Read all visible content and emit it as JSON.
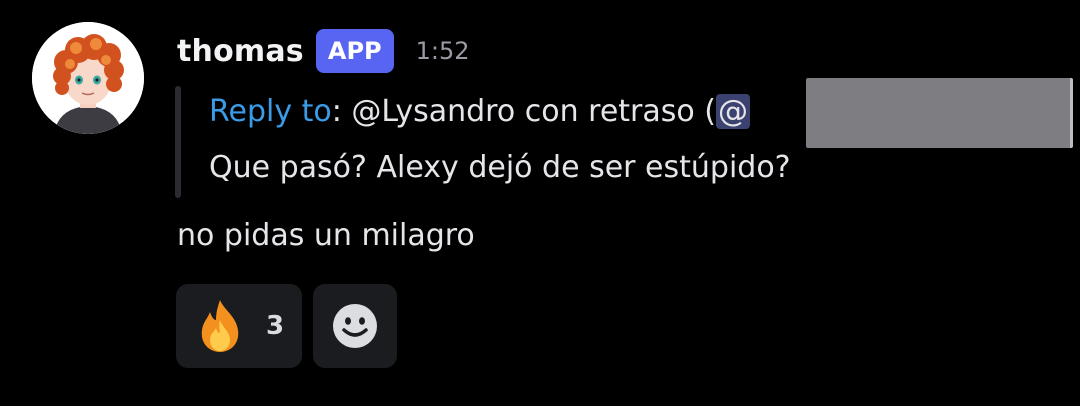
{
  "message": {
    "author": "thomas",
    "badge": "APP",
    "timestamp": "1:52",
    "reply": {
      "prefix_link": "Reply to",
      "colon": ":",
      "target_text": " @Lysandro con retraso (",
      "mention_at": "@",
      "quoted_text": "Que pasó? Alexy dejó de ser estúpido?"
    },
    "body": "no pidas un milagro",
    "reactions": [
      {
        "emoji_icon": "fire-icon",
        "count": "3"
      }
    ],
    "add_reaction_icon": "smiley-icon"
  },
  "colors": {
    "background": "#000000",
    "badge": "#5865f2",
    "link": "#3b9be6",
    "reaction_bg": "#1b1c1f"
  }
}
